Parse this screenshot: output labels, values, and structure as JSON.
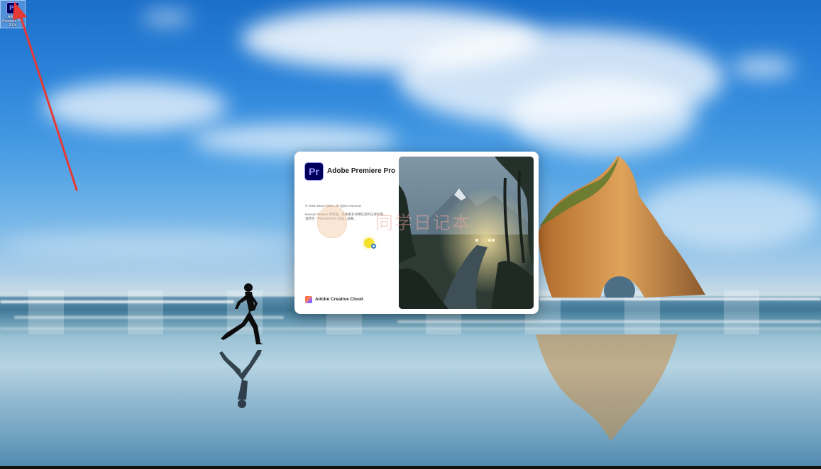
{
  "desktop": {
    "icons": [
      {
        "label": "Adobe Premiere Pro 2024",
        "glyph": "Pr",
        "icon": "premiere-pro-icon"
      }
    ],
    "annotation": {
      "color": "#e53935",
      "shape": "arrow"
    }
  },
  "splash": {
    "logo_text": "Pr",
    "title": "Adobe Premiere Pro",
    "copyright": "© 1991-2023 Adobe. All rights reserved.",
    "credits": "Keenan Shabee 的作品。有关更多详细信息和法律声明，请转至「Premiere Pro 启动」屏幕。",
    "footer_label": "Adobe Creative Cloud",
    "footer_icon": "creative-cloud-icon",
    "status_icon": "loading-spinner-icon"
  },
  "watermark": {
    "text": "同学日记本"
  },
  "colors": {
    "premiere_bg": "#00005b",
    "premiere_accent": "#9999ff",
    "arrow": "#e53935"
  }
}
